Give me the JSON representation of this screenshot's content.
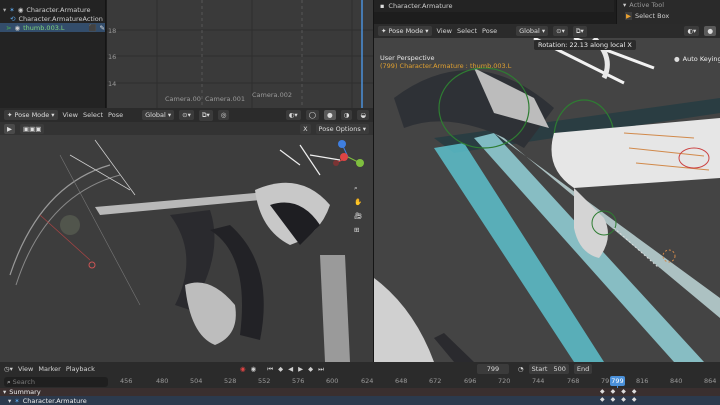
{
  "outliner": {
    "items": [
      {
        "label": "Character.Armature"
      },
      {
        "label": "Character.ArmatureAction"
      },
      {
        "label": "thumb.003.L"
      }
    ]
  },
  "graph": {
    "y_ticks": [
      "18",
      "16",
      "14"
    ],
    "cameras": [
      "Camera.00",
      "Camera.001",
      "Camera.002"
    ]
  },
  "left_view": {
    "mode": "Pose Mode",
    "menus": [
      "View",
      "Select",
      "Pose"
    ],
    "orientation": "Global",
    "pose_options": "Pose Options",
    "x_label": "X"
  },
  "right_view": {
    "mode": "Pose Mode",
    "menus": [
      "View",
      "Select",
      "Pose"
    ],
    "orientation": "Global",
    "title": "Character.Armature",
    "perspective": "User Perspective",
    "object_info": "(799) Character.Armature : thumb.003.L",
    "status": "Rotation: 22.13 along local X",
    "auto_keying": "Auto Keying C"
  },
  "properties": {
    "active_tool": "Active Tool",
    "select_box": "Select Box"
  },
  "timeline": {
    "menus": [
      "View",
      "Marker",
      "Playback"
    ],
    "current_frame": "799",
    "start_label": "Start",
    "start_value": "500",
    "end_label": "End",
    "search_placeholder": "Search",
    "frame_ticks": [
      "456",
      "480",
      "504",
      "528",
      "552",
      "576",
      "600",
      "624",
      "648",
      "672",
      "696",
      "720",
      "744",
      "768",
      "79",
      "816",
      "840",
      "864"
    ],
    "playhead_label": "799",
    "summary": "Summary",
    "armature_row": "Character.Armature"
  },
  "colors": {
    "accent": "#4772b3",
    "playhead": "#4a90d9",
    "bone_green": "#2e7d32",
    "summary_red": "#d94040"
  }
}
